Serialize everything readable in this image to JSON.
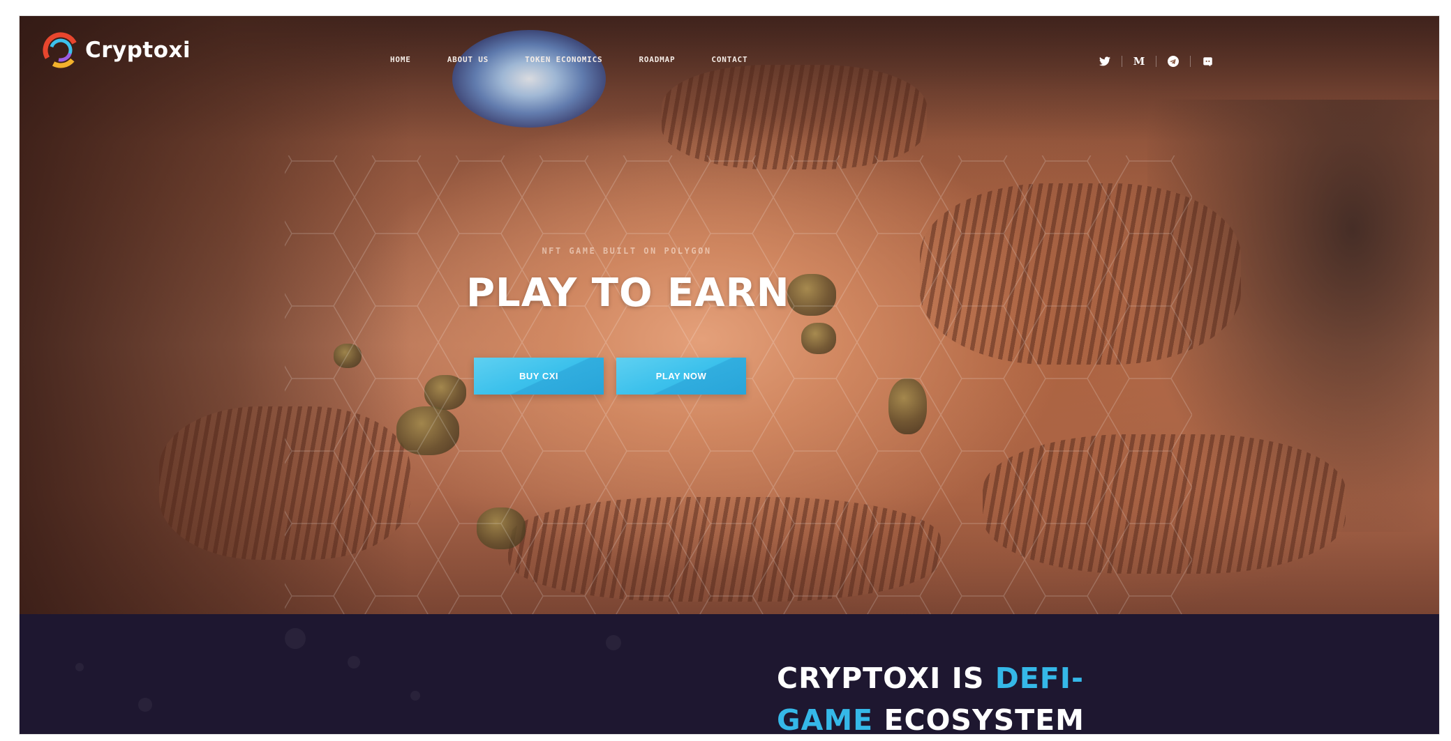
{
  "brand": {
    "name": "Cryptoxi"
  },
  "nav": {
    "items": [
      "HOME",
      "ABOUT US",
      "TOKEN ECONOMICS",
      "ROADMAP",
      "CONTACT"
    ]
  },
  "socials": {
    "icons": [
      "twitter-icon",
      "medium-icon",
      "telegram-icon",
      "discord-icon"
    ],
    "medium_glyph": "M"
  },
  "hero": {
    "subtitle": "NFT GAME BUILT ON POLYGON",
    "title": "PLAY TO EARN",
    "buy_label": "BUY CXI",
    "play_label": "PLAY NOW"
  },
  "ecosystem": {
    "title_part1": "CRYPTOXI IS ",
    "title_highlight1": "DEFI-",
    "title_highlight2": "GAME",
    "title_part2": " ECOSYSTEM"
  },
  "colors": {
    "accent": "#35b8e8",
    "section_bg": "#1e1730",
    "button": "#3cc1ec"
  }
}
